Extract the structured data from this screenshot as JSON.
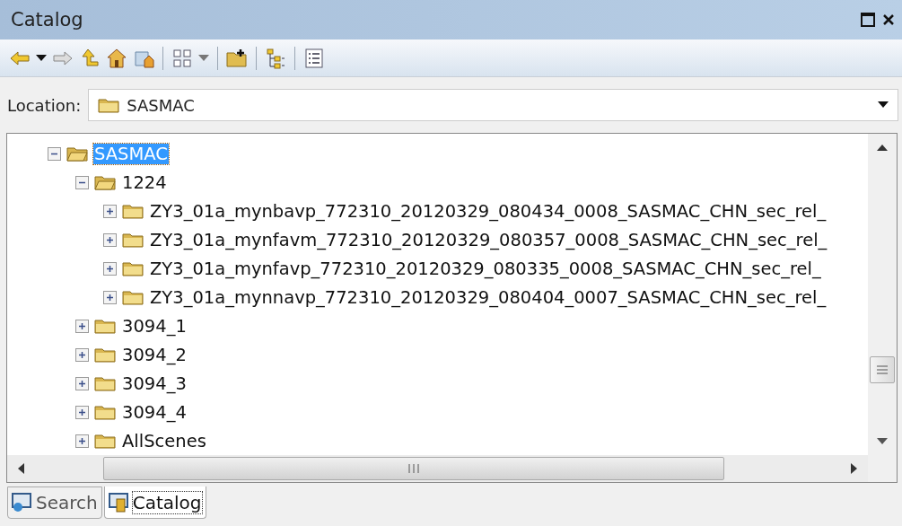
{
  "window": {
    "title": "Catalog"
  },
  "location": {
    "label": "Location:",
    "value": "SASMAC"
  },
  "tree": [
    {
      "name": "SASMAC",
      "expanded": true,
      "selected": true,
      "children": [
        {
          "name": "1224",
          "expanded": true,
          "selected": false,
          "children": [
            {
              "name": "ZY3_01a_mynbavp_772310_20120329_080434_0008_SASMAC_CHN_sec_rel_",
              "expanded": false,
              "selected": false
            },
            {
              "name": "ZY3_01a_mynfavm_772310_20120329_080357_0008_SASMAC_CHN_sec_rel_",
              "expanded": false,
              "selected": false
            },
            {
              "name": "ZY3_01a_mynfavp_772310_20120329_080335_0008_SASMAC_CHN_sec_rel_",
              "expanded": false,
              "selected": false
            },
            {
              "name": "ZY3_01a_mynnavp_772310_20120329_080404_0007_SASMAC_CHN_sec_rel_",
              "expanded": false,
              "selected": false
            }
          ]
        },
        {
          "name": "3094_1",
          "expanded": false,
          "selected": false
        },
        {
          "name": "3094_2",
          "expanded": false,
          "selected": false
        },
        {
          "name": "3094_3",
          "expanded": false,
          "selected": false
        },
        {
          "name": "3094_4",
          "expanded": false,
          "selected": false
        },
        {
          "name": "AllScenes",
          "expanded": false,
          "selected": false
        }
      ]
    }
  ],
  "tabs": [
    {
      "label": "Search",
      "selected": false
    },
    {
      "label": "Catalog",
      "selected": true
    }
  ]
}
